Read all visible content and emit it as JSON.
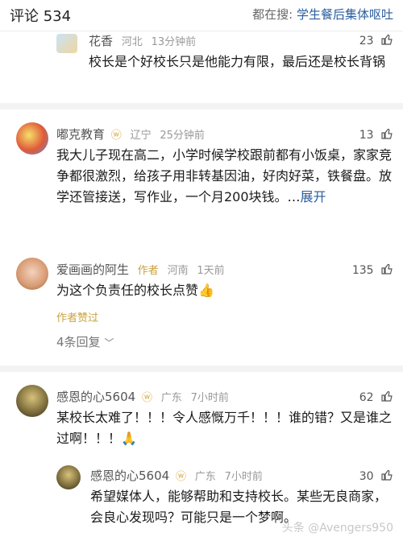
{
  "header": {
    "title": "评论 534",
    "search_prefix": "都在搜:",
    "search_keyword": "学生餐后集体呕吐"
  },
  "comments": [
    {
      "name": "花香",
      "location": "河北",
      "time": "13分钟前",
      "likes": "23",
      "text": "校长是个好校长只是他能力有限，最后还是校长背锅"
    },
    {
      "name": "嘟克教育",
      "location": "辽宁",
      "time": "25分钟前",
      "likes": "13",
      "text": "我大儿子现在高二，小学时候学校跟前都有小饭桌，家家竞争都很激烈，给孩子用非转基因油，好肉好菜，铁餐盘。放学还管接送，写作业，一个月200块钱。…",
      "expand": "展开"
    },
    {
      "name": "爱画画的阿生",
      "author_tag": "作者",
      "location": "河南",
      "time": "1天前",
      "likes": "135",
      "text": "为这个负责任的校长点赞👍",
      "author_liked": "作者赞过",
      "replies": "4条回复"
    },
    {
      "name": "感恩的心5604",
      "location": "广东",
      "time": "7小时前",
      "likes": "62",
      "text": "某校长太难了！！！令人感慨万千！！！谁的错？又是谁之过啊！！！🙏"
    },
    {
      "name": "感恩的心5604",
      "location": "广东",
      "time": "7小时前",
      "likes": "30",
      "text": "希望媒体人，能够帮助和支持校长。某些无良商家，会良心发现吗？可能只是一个梦啊。"
    }
  ],
  "watermark": "头条 @Avengers950",
  "colors": {
    "link": "#2a5d9e",
    "vip": "#d4a73a",
    "author": "#c9a23e",
    "muted": "#999999"
  }
}
